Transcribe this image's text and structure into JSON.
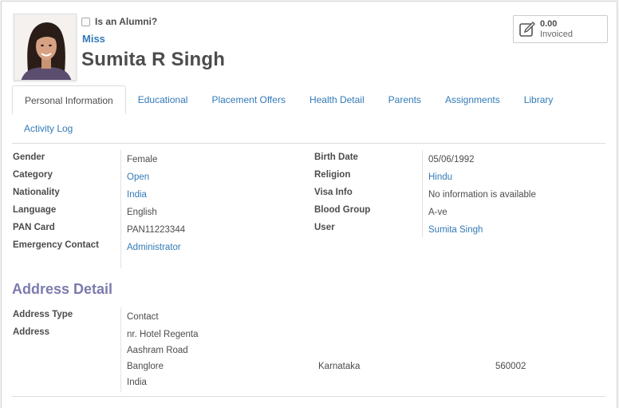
{
  "header": {
    "alumni_label": "Is an Alumni?",
    "salutation": "Miss",
    "name": "Sumita R Singh"
  },
  "stat_button": {
    "value": "0.00",
    "label": "Invoiced",
    "icon": "edit-icon"
  },
  "tabs": [
    {
      "label": "Personal Information",
      "active": true
    },
    {
      "label": "Educational"
    },
    {
      "label": "Placement Offers"
    },
    {
      "label": "Health Detail"
    },
    {
      "label": "Parents"
    },
    {
      "label": "Assignments"
    },
    {
      "label": "Library"
    },
    {
      "label": "Activity Log"
    }
  ],
  "personal": {
    "left": [
      {
        "label": "Gender",
        "value": "Female"
      },
      {
        "label": "Category",
        "value": "Open"
      },
      {
        "label": "Nationality",
        "value": "India"
      },
      {
        "label": "Language",
        "value": "English"
      },
      {
        "label": "PAN Card",
        "value": "PAN11223344"
      },
      {
        "label": "Emergency Contact",
        "value": "Administrator"
      }
    ],
    "right": [
      {
        "label": "Birth Date",
        "value": "05/06/1992"
      },
      {
        "label": "Religion",
        "value": "Hindu"
      },
      {
        "label": "Visa Info",
        "value": "No information is available"
      },
      {
        "label": "Blood Group",
        "value": "A-ve"
      },
      {
        "label": "User",
        "value": "Sumita Singh"
      }
    ]
  },
  "address": {
    "title": "Address Detail",
    "type_label": "Address Type",
    "type_value": "Contact",
    "address_label": "Address",
    "street": "nr. Hotel Regenta",
    "street2": "Aashram Road",
    "city": "Banglore",
    "state": "Karnataka",
    "zip": "560002",
    "country": "India"
  },
  "colors": {
    "link": "#337ab7",
    "section_title": "#7c7bad",
    "text": "#4c4c4c"
  }
}
